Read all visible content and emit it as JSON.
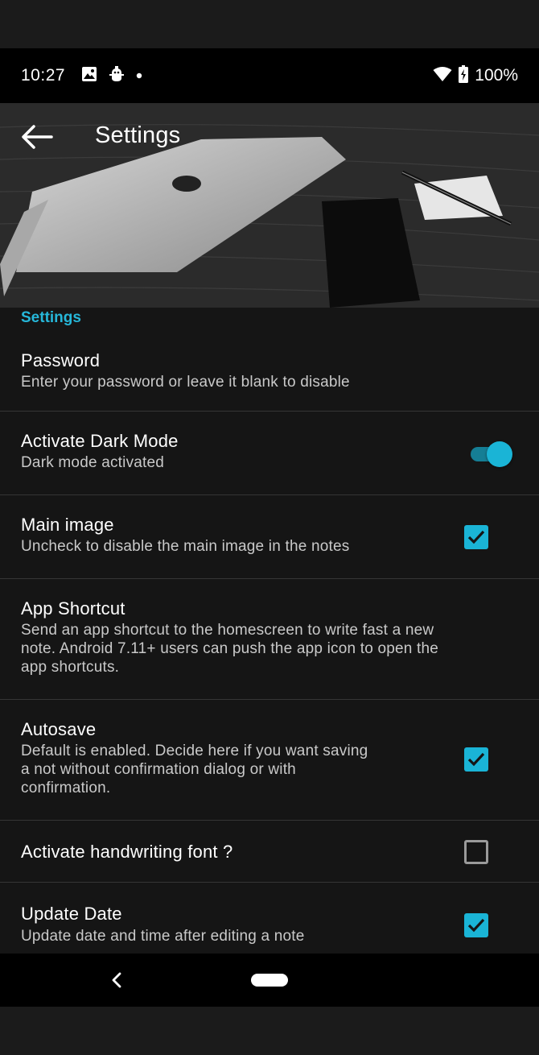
{
  "status_bar": {
    "time": "10:27",
    "battery": "100%",
    "icons": [
      "image-icon",
      "android-debug-icon",
      "dot-icon",
      "wifi-icon",
      "battery-charging-icon"
    ]
  },
  "header": {
    "title": "Settings",
    "back_icon": "arrow-back-icon"
  },
  "section": {
    "title": "Settings"
  },
  "preferences": [
    {
      "title": "Password",
      "summary": "Enter your password or leave it blank to disable",
      "widget": "none"
    },
    {
      "title": "Activate Dark Mode",
      "summary": "Dark mode activated",
      "widget": "switch",
      "on": true
    },
    {
      "title": "Main image",
      "summary": "Uncheck to disable the main image in the notes",
      "widget": "checkbox",
      "checked": true
    },
    {
      "title": "App Shortcut",
      "summary_lines": [
        "Send an app shortcut to the homescreen to write fast a new",
        "note. Android 7.11+ users can push the app icon to open the",
        "app shortcuts."
      ],
      "widget": "none"
    },
    {
      "title": "Autosave",
      "summary_lines": [
        "Default is enabled. Decide here if you want saving",
        "a not without confirmation dialog or with",
        "confirmation."
      ],
      "widget": "checkbox",
      "checked": true
    },
    {
      "title": "Activate handwriting font ?",
      "widget": "checkbox",
      "checked": false
    },
    {
      "title": "Update Date",
      "summary": "Update date and time after editing a note",
      "widget": "checkbox",
      "checked": true
    }
  ],
  "colors": {
    "accent": "#1ab4d6",
    "background": "#151515",
    "status_bar": "#000000"
  },
  "nav_bar": {
    "icons": [
      "nav-back-icon",
      "nav-home-pill"
    ]
  }
}
